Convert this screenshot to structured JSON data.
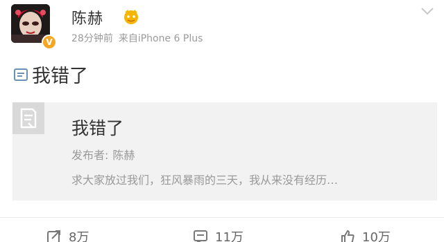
{
  "post": {
    "username": "陈赫",
    "time": "28分钟前",
    "source": "来自iPhone 6 Plus",
    "text": "我错了"
  },
  "article": {
    "title": "我错了",
    "author_label": "发布者:",
    "author": "陈赫",
    "summary": "求大家放过我们，狂风暴雨的三天，我从来没有经历…"
  },
  "actions": {
    "repost_count": "8万",
    "comment_count": "11万",
    "like_count": "10万"
  },
  "colors": {
    "text_primary": "#333333",
    "text_secondary": "#999999",
    "card_bg": "#f2f2f2",
    "verified_badge": "#f5a623",
    "member_icon": "#f6b500"
  },
  "icons": {
    "avatar": "avatar",
    "verified": "verified-badge-icon",
    "member": "member-crown-icon",
    "dropdown": "chevron-down-icon",
    "article": "article-icon",
    "repost": "repost-icon",
    "comment": "comment-icon",
    "like": "thumbs-up-icon"
  }
}
